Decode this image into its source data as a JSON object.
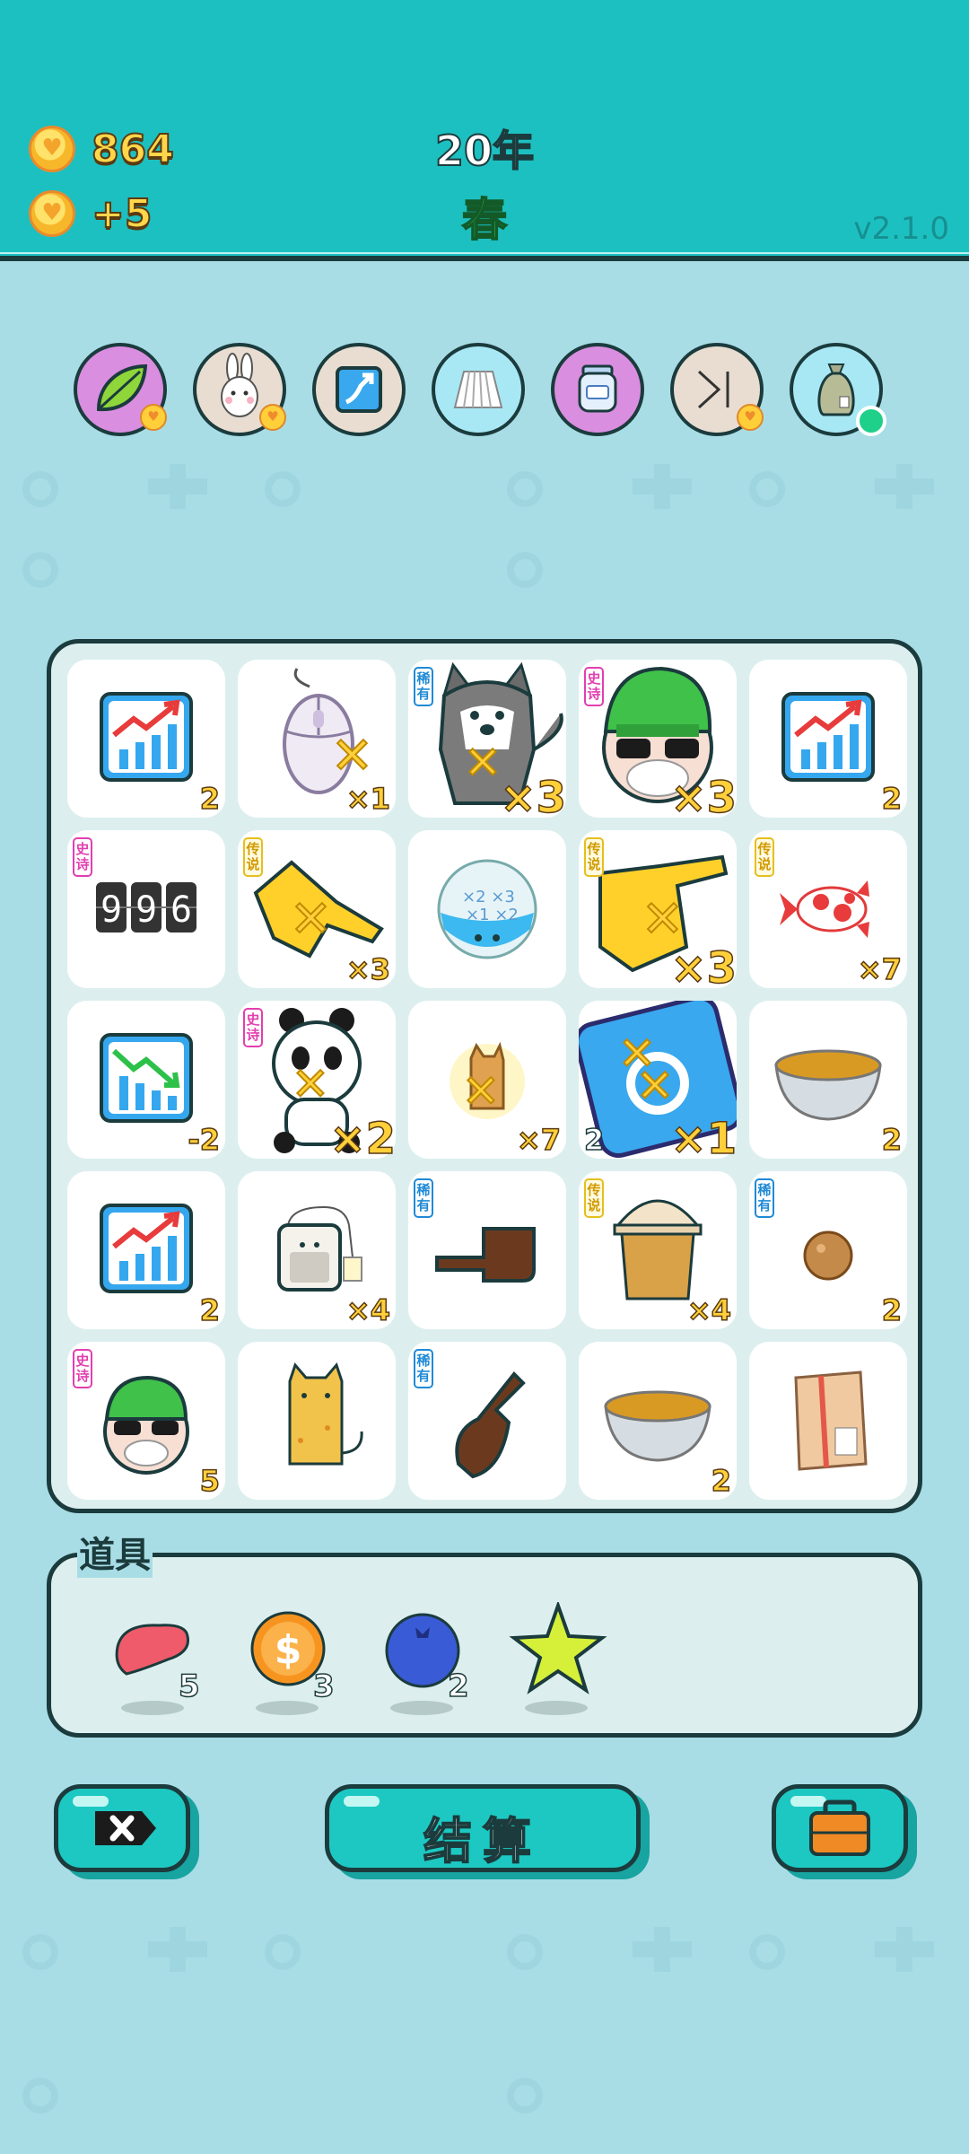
{
  "header": {
    "coins": "864",
    "income": "+5",
    "year": "20年",
    "season": "春",
    "version": "v2.1.0"
  },
  "relics": [
    {
      "name": "leaf-relic",
      "color": "#d98ee0"
    },
    {
      "name": "rabbit-relic",
      "color": "#e8ddd0"
    },
    {
      "name": "growth-card-relic",
      "color": "#e8ddd0"
    },
    {
      "name": "pleated-skirt-relic",
      "color": "#a8e8f4"
    },
    {
      "name": "jar-relic",
      "color": "#d98ee0"
    },
    {
      "name": "skip-relic",
      "color": "#e8ddd0"
    },
    {
      "name": "bag-relic",
      "color": "#a8e8f4"
    }
  ],
  "board": {
    "cells": [
      {
        "item": "chart-up-icon",
        "count": "2",
        "rarity": ""
      },
      {
        "item": "mouse-icon",
        "count": "×1",
        "rarity": ""
      },
      {
        "item": "husky-icon",
        "count": "×3",
        "rarity": "稀有"
      },
      {
        "item": "green-hat-man-icon",
        "count": "×3",
        "rarity": "史诗"
      },
      {
        "item": "chart-up-icon",
        "count": "2",
        "rarity": ""
      },
      {
        "item": "996-counter-icon",
        "count": "",
        "rarity": "史诗"
      },
      {
        "item": "yellow-hand-icon",
        "count": "×3",
        "rarity": "传说"
      },
      {
        "item": "multiplier-ball-icon",
        "count": "",
        "rarity": ""
      },
      {
        "item": "yellow-finger-icon",
        "count": "×3",
        "rarity": "传说"
      },
      {
        "item": "koi-fish-icon",
        "count": "×7",
        "rarity": "传说"
      },
      {
        "item": "chart-down-icon",
        "count": "-2",
        "rarity": ""
      },
      {
        "item": "panda-icon",
        "count": "×2",
        "rarity": "史诗"
      },
      {
        "item": "small-cat-icon",
        "count": "×7",
        "rarity": ""
      },
      {
        "item": "blue-card-icon",
        "count": "×1",
        "left_count": "2",
        "rarity": ""
      },
      {
        "item": "tea-bowl-icon",
        "count": "2",
        "rarity": ""
      },
      {
        "item": "chart-up-icon",
        "count": "2",
        "rarity": ""
      },
      {
        "item": "tea-bag-icon",
        "count": "×4",
        "rarity": ""
      },
      {
        "item": "brown-hand-icon",
        "count": "",
        "rarity": "稀有"
      },
      {
        "item": "milk-tea-icon",
        "count": "×4",
        "rarity": "传说"
      },
      {
        "item": "longan-icon",
        "count": "2",
        "rarity": "稀有"
      },
      {
        "item": "green-hat-man-icon",
        "count": "5",
        "rarity": "史诗"
      },
      {
        "item": "cat-icon",
        "count": "",
        "rarity": ""
      },
      {
        "item": "brown-finger-icon",
        "count": "",
        "rarity": "稀有"
      },
      {
        "item": "tea-bowl-icon",
        "count": "2",
        "rarity": ""
      },
      {
        "item": "parcel-box-icon",
        "count": "",
        "rarity": ""
      }
    ]
  },
  "props": {
    "title": "道具",
    "items": [
      {
        "item": "liver-icon",
        "count": "5"
      },
      {
        "item": "dollar-coin-icon",
        "count": "3"
      },
      {
        "item": "blueberry-icon",
        "count": "2"
      },
      {
        "item": "star-icon",
        "count": ""
      }
    ]
  },
  "buttons": {
    "settle_label": "结算"
  }
}
